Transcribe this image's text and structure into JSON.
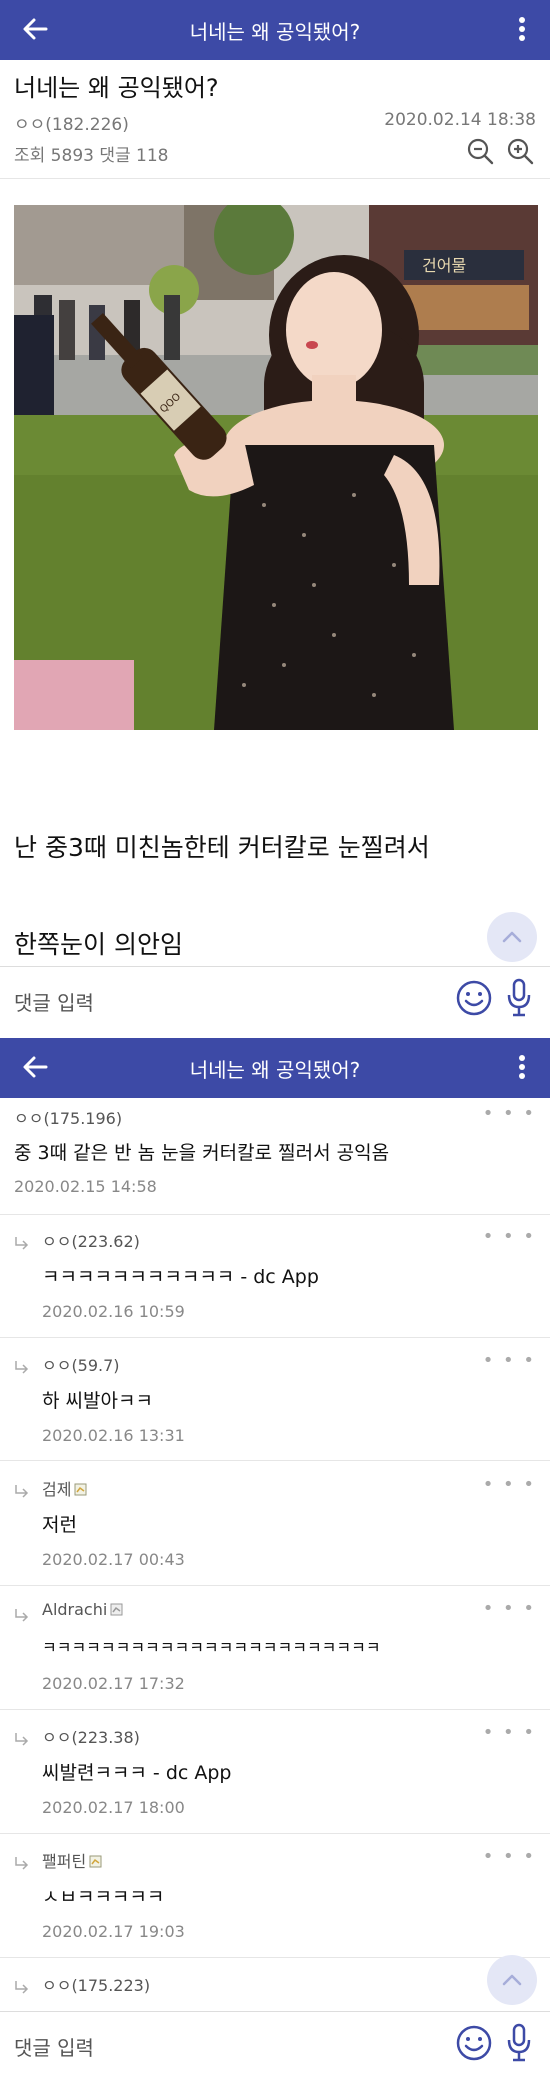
{
  "app": {
    "title": "너네는 왜 공익됐어?"
  },
  "post": {
    "title": "너네는 왜 공익됐어?",
    "author": "ㅇㅇ(182.226)",
    "datetime": "2020.02.14 18:38",
    "stats": "조회 5893 댓글 118",
    "photo_sign": "건어물",
    "bottle_label": "QOO",
    "body_line1": "난 중3때 미친놈한테 커터칼로 눈찔려서",
    "body_line2": "한쪽눈이 의안임"
  },
  "comment_input": {
    "placeholder": "댓글 입력"
  },
  "comments": [
    {
      "author": "ㅇㅇ(175.196)",
      "text": "중 3때 같은 반 놈 눈을 커터칼로 찔러서 공익옴",
      "date": "2020.02.15 14:58"
    },
    {
      "author": "ㅇㅇ(223.62)",
      "text": "ㅋㅋㅋㅋㅋㅋㅋㅋㅋㅋㅋ - dc App",
      "date": "2020.02.16 10:59"
    },
    {
      "author": "ㅇㅇ(59.7)",
      "text": "하 씨발아ㅋㅋ",
      "date": "2020.02.16 13:31"
    },
    {
      "author": "검제",
      "text": "저런",
      "date": "2020.02.17 00:43"
    },
    {
      "author": "Aldrachi",
      "text": "ㅋㅋㅋㅋㅋㅋㅋㅋㅋㅋㅋㅋㅋㅋㅋㅋㅋㅋㅋㅋㅋㅋㅋ",
      "date": "2020.02.17 17:32"
    },
    {
      "author": "ㅇㅇ(223.38)",
      "text": "씨발련ㅋㅋㅋ - dc App",
      "date": "2020.02.17 18:00"
    },
    {
      "author": "팰퍼틴",
      "text": "ㅅㅂㅋㅋㅋㅋㅋ",
      "date": "2020.02.17 19:03"
    },
    {
      "author": "ㅇㅇ(175.223)"
    }
  ],
  "more_dots": "• • •",
  "colors": {
    "appbar": "#3d4aa6",
    "fab": "#e4e7f6",
    "accent": "#3d4aa6"
  },
  "icons": [
    "back-arrow-icon",
    "more-vertical-icon",
    "zoom-out-icon",
    "zoom-in-icon",
    "scroll-top-icon",
    "emoji-icon",
    "mic-icon",
    "reply-arrow-icon",
    "gallog-badge-icon"
  ]
}
